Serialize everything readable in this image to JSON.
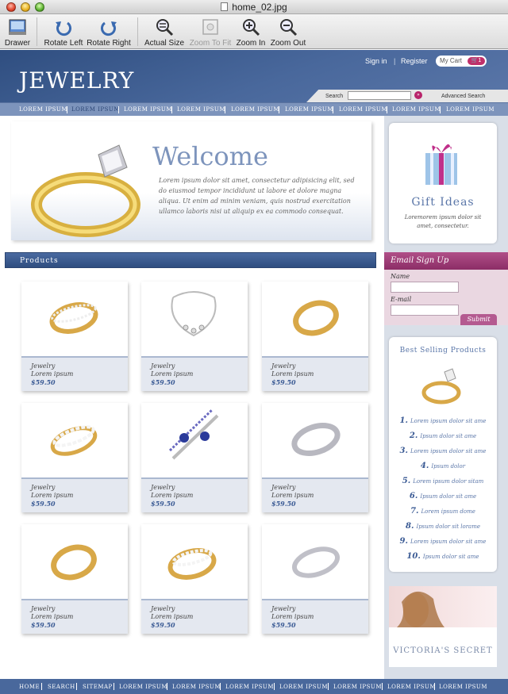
{
  "window": {
    "title": "home_02.jpg"
  },
  "toolbar": {
    "drawer": "Drawer",
    "rotate_left": "Rotate Left",
    "rotate_right": "Rotate Right",
    "actual_size": "Actual Size",
    "zoom_to_fit": "Zoom To Fit",
    "zoom_in": "Zoom In",
    "zoom_out": "Zoom Out"
  },
  "site": {
    "logo": "JEWELRY",
    "sign_in": "Sign in",
    "register": "Register",
    "cart_label": "My Cart",
    "cart_count": "1",
    "search_label": "Search",
    "search_go": "»",
    "advanced_search": "Advanced Search",
    "nav": [
      "LOREM IPSUM",
      "LOREM IPSUM",
      "LOREM IPSUM",
      "LOREM IPSUM",
      "LOREM IPSUM",
      "LOREM IPSUM",
      "LOREM IPSUM",
      "LOREM IPSUM",
      "LOREM IPSUM"
    ],
    "welcome_title": "Welcome",
    "welcome_text": "Lorem ipsum dolor sit amet, consectetur adipisicing elit, sed do eiusmod tempor incididunt ut labore et dolore magna aliqua. Ut enim ad minim veniam, quis nostrud exercitation ullamco laboris nisi ut aliquip ex ea commodo consequat.",
    "products_heading": "Products",
    "products": [
      {
        "line1": "Jewelry",
        "line2": "Lorem ipsum",
        "price": "$59.50",
        "kind": "ring-diamond-band"
      },
      {
        "line1": "Jewelry",
        "line2": "Lorem ipsum",
        "price": "$59.50",
        "kind": "necklace"
      },
      {
        "line1": "Jewelry",
        "line2": "Lorem ipsum",
        "price": "$59.50",
        "kind": "ring-gold"
      },
      {
        "line1": "Jewelry",
        "line2": "Lorem ipsum",
        "price": "$59.50",
        "kind": "ring-baguette"
      },
      {
        "line1": "Jewelry",
        "line2": "Lorem ipsum",
        "price": "$59.50",
        "kind": "ring-sapphire"
      },
      {
        "line1": "Jewelry",
        "line2": "Lorem ipsum",
        "price": "$59.50",
        "kind": "ring-silver"
      },
      {
        "line1": "Jewelry",
        "line2": "Lorem ipsum",
        "price": "$59.50",
        "kind": "ring-gold"
      },
      {
        "line1": "Jewelry",
        "line2": "Lorem ipsum",
        "price": "$59.50",
        "kind": "ring-diamond-band"
      },
      {
        "line1": "Jewelry",
        "line2": "Lorem ipsum",
        "price": "$59.50",
        "kind": "ring-silver"
      }
    ],
    "gift_title": "Gift Ideas",
    "gift_text": "Loremorem ipsum dolor sit amet, consectetur.",
    "email_heading": "Email Sign Up",
    "email_name_label": "Name",
    "email_email_label": "E-mail",
    "email_submit": "Submit",
    "best_title": "Best Selling Products",
    "best_items": [
      {
        "num": "1.",
        "text": "Lorem ipsum dolor sit ame"
      },
      {
        "num": "2.",
        "text": "Ipsum dolor sit ame"
      },
      {
        "num": "3.",
        "text": "Lorem ipsum dolor sit ame"
      },
      {
        "num": "4.",
        "text": "Ipsum dolor"
      },
      {
        "num": "5.",
        "text": "Lorem ipsum dolor sitam"
      },
      {
        "num": "6.",
        "text": "Ipsum dolor sit ame"
      },
      {
        "num": "7.",
        "text": "Lorem ipsum dome"
      },
      {
        "num": "8.",
        "text": "Ipsum dolor sit lorame"
      },
      {
        "num": "9.",
        "text": "Lorem ipsum dolor sit ame"
      },
      {
        "num": "10.",
        "text": "Ipsum dolor sit ame"
      }
    ],
    "ad_brand": "VICTORIA'S SECRET",
    "footer": [
      "HOME",
      "SEARCH",
      "SITEMAP",
      "LOREM IPSUM",
      "LOREM IPSUM",
      "LOREM IPSUM",
      "LOREM IPSUM",
      "LOREM IPSUM",
      "LOREM IPSUM",
      "LOREM IPSUM"
    ]
  },
  "colors": {
    "brand_blue": "#49689c",
    "nav_blue": "#7d94bc",
    "email_magenta": "#9c3a74",
    "price_blue": "#3a5a94"
  }
}
